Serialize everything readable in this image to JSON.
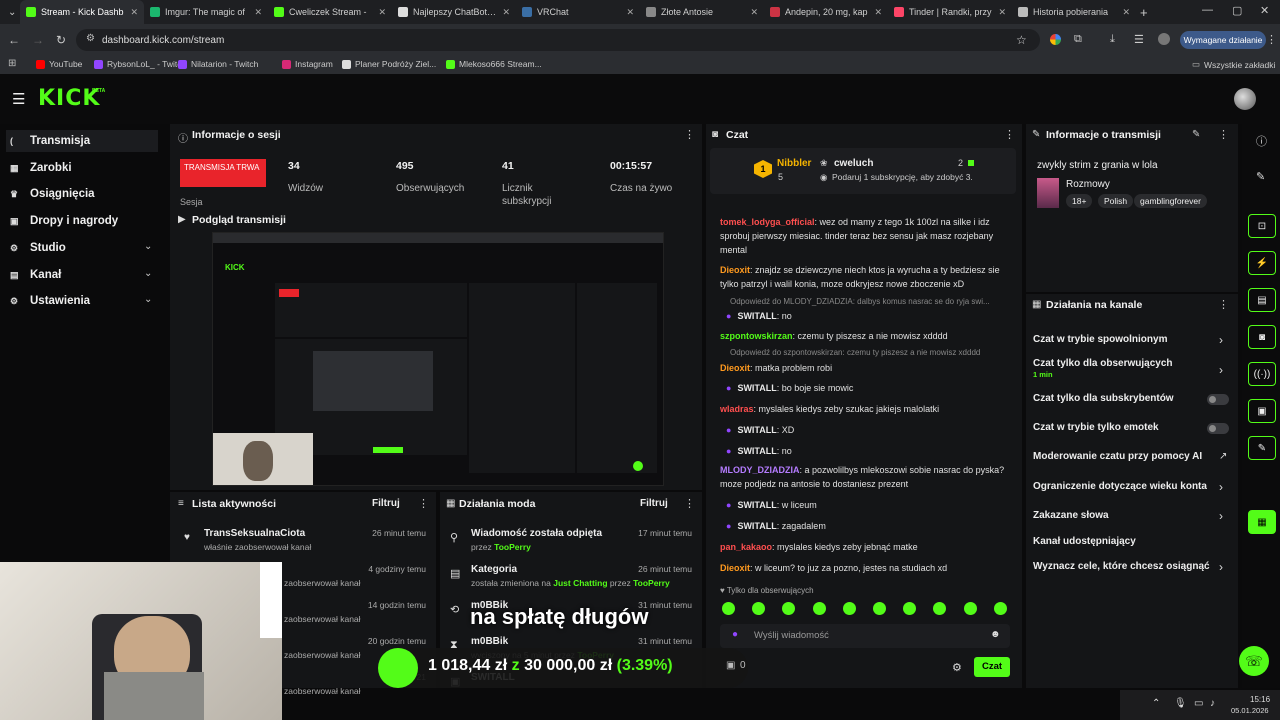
{
  "browser": {
    "tabs": [
      {
        "label": "Stream - Kick Dashb",
        "color": "#53fc18"
      },
      {
        "label": "Imgur: The magic of",
        "color": "#1bb76e"
      },
      {
        "label": "Cweliczek Stream - ",
        "color": "#53fc18"
      },
      {
        "label": "Najlepszy ChatBot i W",
        "color": "#dddddd"
      },
      {
        "label": "VRChat",
        "color": "#3a6ea5"
      },
      {
        "label": "Złote Antosie",
        "color": "#888888"
      },
      {
        "label": "Andepin, 20 mg, kap",
        "color": "#cc3344"
      },
      {
        "label": "Tinder | Randki, przy",
        "color": "#fd4567"
      },
      {
        "label": "Historia pobierania",
        "color": "#bbbbbb"
      }
    ],
    "url": "dashboard.kick.com/stream",
    "action_button": "Wymagane działanie",
    "bookmarks": [
      {
        "label": "YouTube",
        "color": "#ff0000"
      },
      {
        "label": "RybsonLoL_ - Twitch",
        "color": "#9146ff"
      },
      {
        "label": "Nilatarion - Twitch",
        "color": "#9146ff"
      },
      {
        "label": "Instagram",
        "color": "#d62976"
      },
      {
        "label": "Planer Podróży Ziel...",
        "color": "#dddddd"
      },
      {
        "label": "Mlekoso666 Stream...",
        "color": "#53fc18"
      }
    ],
    "all_bookmarks": "Wszystkie zakładki"
  },
  "app": {
    "logo": "KICK",
    "beta": "BETA",
    "accent": "#53fc18",
    "nav": [
      {
        "label": "Transmisja",
        "icon": "broadcast-icon",
        "active": true
      },
      {
        "label": "Zarobki",
        "icon": "earnings-icon"
      },
      {
        "label": "Osiągnięcia",
        "icon": "achievements-icon"
      },
      {
        "label": "Dropy i nagrody",
        "icon": "drops-icon"
      },
      {
        "label": "Studio",
        "icon": "studio-icon"
      },
      {
        "label": "Kanał",
        "icon": "channel-icon"
      },
      {
        "label": "Ustawienia",
        "icon": "settings-icon"
      }
    ]
  },
  "session": {
    "title": "Informacje o sesji",
    "live_badge": "TRANSMISJA TRWA",
    "session_label": "Sesja",
    "stats": [
      {
        "value": "34",
        "label": "Widzów"
      },
      {
        "value": "495",
        "label": "Obserwujących"
      },
      {
        "value": "41",
        "label": "Licznik subskrypcji"
      },
      {
        "value": "00:15:57",
        "label": "Czas na żywo"
      }
    ]
  },
  "preview": {
    "title": "Podgląd transmisji"
  },
  "activity": {
    "title": "Lista aktywności",
    "filter": "Filtruj",
    "items": [
      {
        "name": "TransSeksualnaCiota",
        "desc": "właśnie zaobserwował kanał",
        "time": "26 minut temu"
      },
      {
        "name": "",
        "desc": "zaobserwował kanał",
        "time": "4 godziny temu"
      },
      {
        "name": "",
        "desc": "zaobserwował kanał",
        "time": "14 godzin temu"
      },
      {
        "name": "",
        "desc": "zaobserwował kanał",
        "time": "20 godzin temu"
      },
      {
        "name": "",
        "desc": "zaobserwował kanał",
        "time": "21"
      }
    ]
  },
  "mod": {
    "title": "Działania moda",
    "filter": "Filtruj",
    "items": [
      {
        "title": "Wiadomość została odpięta",
        "sub": "przez",
        "who": "TooPerry",
        "time": "17 minut temu"
      },
      {
        "title": "Kategoria",
        "sub": "została zmieniona na",
        "cat": "Just Chatting",
        "by": "przez",
        "who": "TooPerry",
        "time": "26 minut temu"
      },
      {
        "title": "m0BBik",
        "time": "31 minut temu"
      },
      {
        "title": "m0BBik",
        "sub": "wyciszony na 5 minut przez",
        "who": "TooPerry",
        "time": "31 minut temu"
      },
      {
        "title": "SWITALL"
      }
    ]
  },
  "overlay": {
    "caption": "na spłatę długów",
    "amount": "1 018,44 zł",
    "z": "z",
    "goal": "30 000,00 zł",
    "percent": "(3.39%)",
    "progress": 0.0339,
    "count": "0"
  },
  "chat": {
    "title": "Czat",
    "pinned": {
      "user": "Nibbler",
      "user_count": "5",
      "streamer": "cweluch",
      "streamer_count": "2",
      "subtext": "Podaruj 1 subskrypcję, aby zdobyć 3."
    },
    "messages": [
      {
        "user": "tomek_lodyga_official",
        "color": "#ff4f4f",
        "text": "wez od mamy z tego 1k 100zl na silke i idz sprobuj pierwszy miesiac. tinder teraz bez sensu jak masz rozjebany mental"
      },
      {
        "user": "Dieoxit",
        "color": "#ff9a1f",
        "text": "znajdz se dziewczyne niech ktos ja wyrucha a ty bedziesz sie tylko patrzyl i walil konia, moze odkryjesz nowe zboczenie xD"
      },
      {
        "reply": "Odpowiedź do MLODY_DZIADZIA: dalbys komus nasrac se do ryja swi..."
      },
      {
        "user": "SWITALL",
        "color": "#e8e8e8",
        "text": "no",
        "badge": true
      },
      {
        "user": "szpontowskirzan",
        "color": "#53fc18",
        "text": "czemu ty piszesz a nie mowisz xdddd"
      },
      {
        "reply": "Odpowiedź do szpontowskirzan: czemu ty piszesz a nie mowisz xdddd"
      },
      {
        "user": "Dieoxit",
        "color": "#ff9a1f",
        "text": "matka problem robi"
      },
      {
        "user": "SWITALL",
        "color": "#e8e8e8",
        "text": "bo boje sie mowic",
        "badge": true
      },
      {
        "user": "wladras",
        "color": "#ff4f4f",
        "text": "myslales kiedys zeby szukac jakiejs malolatki"
      },
      {
        "user": "SWITALL",
        "color": "#e8e8e8",
        "text": "XD",
        "badge": true
      },
      {
        "user": "SWITALL",
        "color": "#e8e8e8",
        "text": "no",
        "badge": true
      },
      {
        "user": "MLODY_DZIADZIA",
        "color": "#b57cff",
        "text": "a pozwolilbys mlekoszowi sobie nasrac do pyska? moze podjedz na antosie to dostaniesz prezent"
      },
      {
        "user": "SWITALL",
        "color": "#e8e8e8",
        "text": "w liceum",
        "badge": true
      },
      {
        "user": "SWITALL",
        "color": "#e8e8e8",
        "text": "zagadalem",
        "badge": true
      },
      {
        "user": "pan_kakaoo",
        "color": "#ff4f4f",
        "text": "myslales kiedys zeby jebnąć matke"
      },
      {
        "user": "Dieoxit",
        "color": "#ff9a1f",
        "text": "w liceum? to juz za pozno, jestes na studiach xd"
      }
    ],
    "followers_only": "Tylko dla obserwujących",
    "input_placeholder": "Wyślij wiadomość",
    "send": "Czat"
  },
  "stream_info": {
    "title": "Informacje o transmisji",
    "stream_title": "zwykly strim z grania w lola",
    "category": "Rozmowy",
    "tags": [
      "18+",
      "Polish",
      "gamblingforever"
    ]
  },
  "actions": {
    "title": "Działania na kanale",
    "items": [
      {
        "label": "Czat w trybie spowolnionym",
        "type": "arrow"
      },
      {
        "label": "Czat tylko dla obserwujących",
        "sub": "1 min",
        "type": "arrow"
      },
      {
        "label": "Czat tylko dla subskrybentów",
        "type": "toggle"
      },
      {
        "label": "Czat w trybie tylko emotek",
        "type": "toggle"
      },
      {
        "label": "Moderowanie czatu przy pomocy AI",
        "type": "link"
      },
      {
        "label": "Ograniczenie dotyczące wieku konta",
        "type": "arrow"
      },
      {
        "label": "Zakazane słowa",
        "type": "arrow"
      },
      {
        "label": "Kanał udostępniający",
        "type": "none"
      },
      {
        "label": "Wyznacz cele, które chcesz osiągnąć",
        "type": "arrow"
      }
    ]
  },
  "taskbar": {
    "time": "15:16",
    "date": "05.01.2026"
  }
}
